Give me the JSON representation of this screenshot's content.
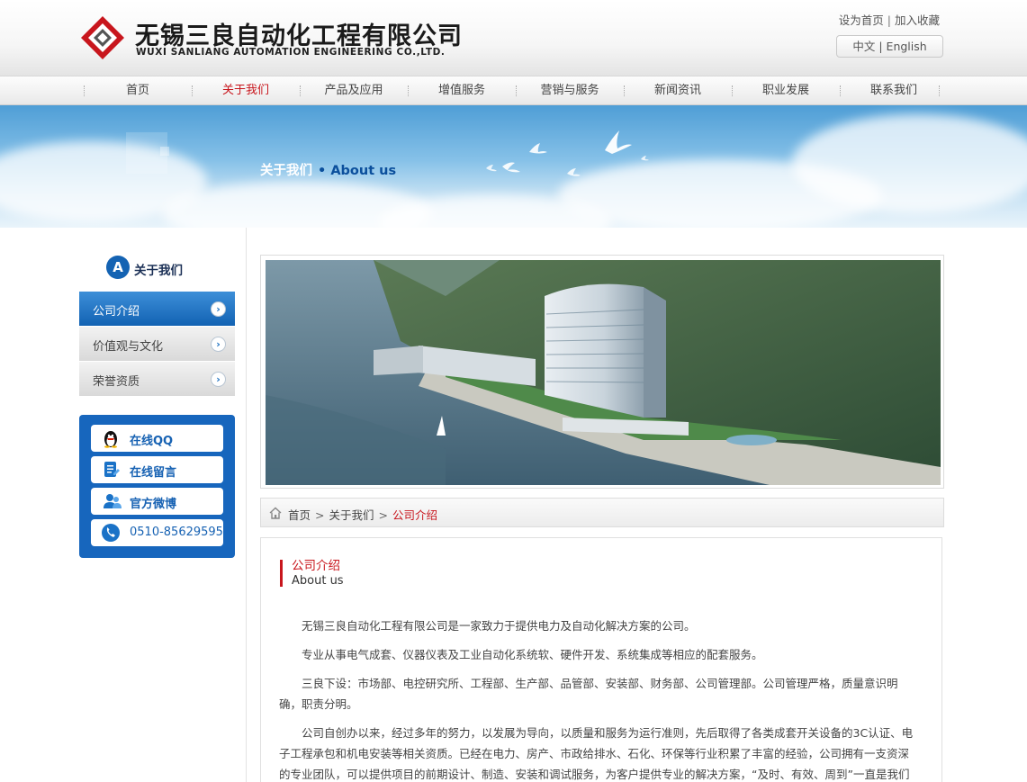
{
  "header": {
    "company_cn": "无锡三良自动化工程有限公司",
    "company_en": "WUXI SANLIANG AUTOMATION ENGINEERING CO.,LTD.",
    "set_home": "设为首页",
    "add_favorite": "加入收藏",
    "lang_cn": "中文",
    "lang_en": "English",
    "separator": "|"
  },
  "nav": {
    "items": [
      {
        "label": "首页"
      },
      {
        "label": "关于我们",
        "active": true
      },
      {
        "label": "产品及应用"
      },
      {
        "label": "增值服务"
      },
      {
        "label": "营销与服务"
      },
      {
        "label": "新闻资讯"
      },
      {
        "label": "职业发展"
      },
      {
        "label": "联系我们"
      }
    ]
  },
  "banner": {
    "title_cn": "关于我们",
    "title_en": "• About us"
  },
  "sidebar": {
    "badge": "A",
    "title": "关于我们",
    "items": [
      {
        "label": "公司介绍",
        "active": true
      },
      {
        "label": "价值观与文化"
      },
      {
        "label": "荣誉资质"
      }
    ],
    "arrow_glyph": "›",
    "contact": [
      {
        "label": "在线QQ",
        "icon": "qq-penguin-icon"
      },
      {
        "label": "在线留言",
        "icon": "message-icon"
      },
      {
        "label": "官方微博",
        "icon": "weibo-people-icon"
      },
      {
        "label": "0510-85629595",
        "icon": "phone-icon"
      }
    ]
  },
  "breadcrumb": {
    "home": "首页",
    "sep": ">",
    "section": "关于我们",
    "current": "公司介绍"
  },
  "content": {
    "title_cn": "公司介绍",
    "title_en": "About us",
    "paragraphs": [
      "无锡三良自动化工程有限公司是一家致力于提供电力及自动化解决方案的公司。",
      "专业从事电气成套、仪器仪表及工业自动化系统软、硬件开发、系统集成等相应的配套服务。",
      "三良下设：市场部、电控研究所、工程部、生产部、品管部、安装部、财务部、公司管理部。公司管理严格，质量意识明确，职责分明。",
      "公司自创办以来，经过多年的努力，以发展为导向，以质量和服务为运行准则，先后取得了各类成套开关设备的3C认证、电子工程承包和机电安装等相关资质。已经在电力、房产、市政给排水、石化、环保等行业积累了丰富的经验，公司拥有一支资深的专业团队，可以提供项目的前期设计、制造、安装和调试服务，为客户提供专业的解决方案，“及时、有效、周到”一直是我们对待客户的原则。"
    ]
  },
  "colors": {
    "accent_red": "#c8161d",
    "brand_blue": "#1766bd"
  }
}
